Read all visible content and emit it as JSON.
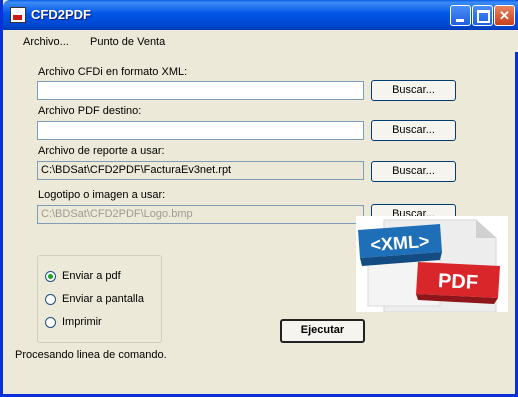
{
  "window": {
    "title": "CFD2PDF"
  },
  "menu": {
    "items": [
      "Archivo...",
      "Punto de Venta"
    ]
  },
  "form": {
    "xml_label": "Archivo CFDi en formato XML:",
    "xml_value": "",
    "pdf_label": "Archivo PDF destino:",
    "pdf_value": "",
    "report_label": "Archivo de reporte a usar:",
    "report_value": "C:\\BDSat\\CFD2PDF\\FacturaEv3net.rpt",
    "logo_label": "Logotipo o imagen a usar:",
    "logo_value": "C:\\BDSat\\CFD2PDF\\Logo.bmp",
    "browse_label": "Buscar...",
    "execute_label": "Ejecutar"
  },
  "options": {
    "items": [
      {
        "label": "Enviar a pdf",
        "checked": true
      },
      {
        "label": "Enviar a pantalla",
        "checked": false
      },
      {
        "label": "Imprimir",
        "checked": false
      }
    ]
  },
  "logo_image": {
    "xml_text": "<XML>",
    "pdf_text": "PDF",
    "xml_color": "#1E6FB8",
    "pdf_color": "#D9262B"
  },
  "status": {
    "text": "Procesando linea de comando."
  }
}
